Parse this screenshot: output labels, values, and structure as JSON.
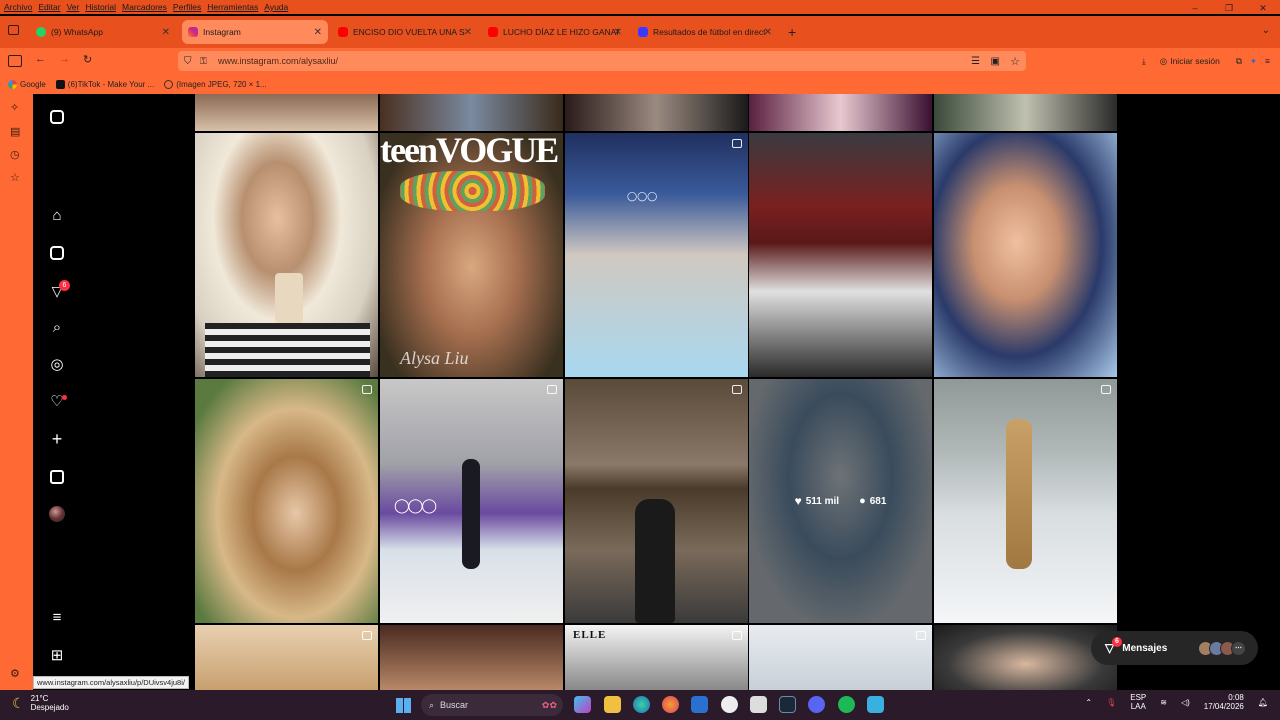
{
  "menubar": {
    "items": [
      "Archivo",
      "Editar",
      "Ver",
      "Historial",
      "Marcadores",
      "Perfiles",
      "Herramientas",
      "Ayuda"
    ]
  },
  "window_controls": {
    "minimize": "–",
    "maximize": "❐",
    "close": "✕"
  },
  "tabs": [
    {
      "label": "(9) WhatsApp",
      "color": "#25d366",
      "active": false
    },
    {
      "label": "Instagram",
      "color": "#d62976",
      "active": true
    },
    {
      "label": "ENCISO DIO VUELTA UNA SERIE",
      "color": "#ff0000",
      "active": false
    },
    {
      "label": "LUCHO DÍAZ LE HIZO GANAR A",
      "color": "#ff0000",
      "active": false
    },
    {
      "label": "Resultados de fútbol en directo",
      "color": "#3a3aff",
      "active": false
    }
  ],
  "new_tab": "+",
  "address": {
    "url": "www.instagram.com/alysaxliu/"
  },
  "nav_right": {
    "signin": "Iniciar sesión"
  },
  "bookmarks": [
    {
      "label": "Google",
      "color": "#4285f4"
    },
    {
      "label": "(6)TikTok - Make Your ...",
      "color": "#111111"
    },
    {
      "label": "(Imagen JPEG, 720 × 1...",
      "color": "#888888"
    }
  ],
  "ig_nav": {
    "notifications_badge": "6"
  },
  "grid": {
    "hover_post": {
      "likes": "511 mil",
      "comments": "681"
    },
    "teen_vogue": "teenVOGUE",
    "teen_vogue_signature": "Alysa Liu",
    "elle": "ELLE"
  },
  "messages": {
    "label": "Mensajes",
    "badge": "6"
  },
  "status_url": "www.instagram.com/alysaxliu/p/DUivsv4ju8i/",
  "taskbar": {
    "temp": "21°C",
    "weather": "Despejado",
    "search": "Buscar",
    "lang_top": "ESP",
    "lang_bottom": "LAA",
    "time": "0:08",
    "date": "17/04/2026"
  }
}
